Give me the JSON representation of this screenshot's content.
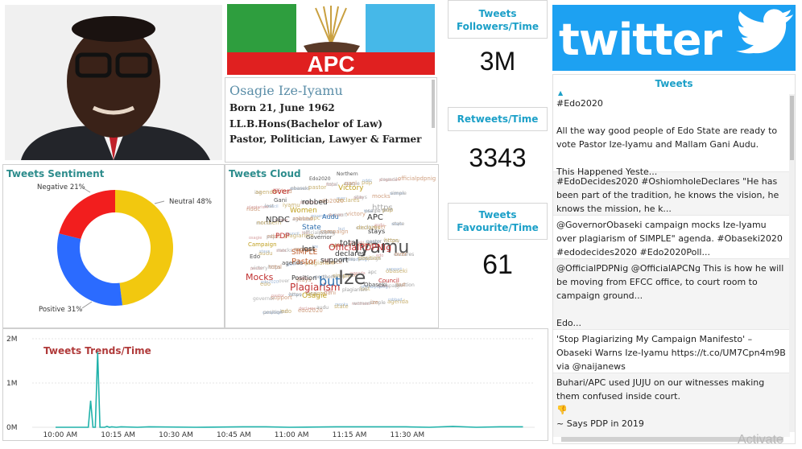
{
  "profile": {
    "name": "Osagie Ize-Iyamu",
    "born": "Born 21, June 1962",
    "degree": "LL.B.Hons(Bachelor of Law)",
    "occupation": "Pastor, Politician, Lawyer & Farmer"
  },
  "party": {
    "logo_text": "APC"
  },
  "kpis": [
    {
      "title": "Tweets Followers/Time",
      "value": "3M"
    },
    {
      "title": "Retweets/Time",
      "value": "3343"
    },
    {
      "title": "Tweets Favourite/Time",
      "value": "61"
    }
  ],
  "twitter": {
    "logo_text": "twitter",
    "header": "Tweets",
    "tweets": [
      "#Edo2020\n\nAll the way good people of Edo State are ready to vote Pastor Ize-Iyamu and Mallam Gani Audu.\n\nThis Happened Yeste...",
      "#EdoDecides2020 #OshiomholeDeclares \"He has been part of the tradition, he knows the vision, he knows the mission, he k...",
      "@GovernorObaseki campaign mocks Ize-Iyamu over plagiarism of SIMPLE\" agenda. #Obaseki2020 #edodecides2020 #Edo2020Poll...",
      "@OfficialPDPNig @OfficialAPCNg This is how he will be moving from EFCC office, to court room to campaign ground...\n\nEdo...",
      "'Stop Plagiarizing My Campaign Manifesto' – Obaseki Warns Ize-Iyamu https://t.co/UM7Cpn4m9B via @naijanews",
      "Buhari/APC used JUJU on our witnesses making them confused inside court.\n👎\n~ Says PDP in 2019"
    ]
  },
  "sentiment": {
    "title": "Tweets Sentiment",
    "labels": [
      "Neutral 48%",
      "Positive 31%",
      "Negative 21%"
    ]
  },
  "cloud": {
    "title": "Tweets  Cloud",
    "words": [
      "Iyamu",
      "Ize",
      "Plagiarism",
      "Mocks",
      "Osagie",
      "over",
      "Pastor",
      "but",
      "APC",
      "OfficialPDPNig",
      "SIMPLE",
      "NDDC",
      "State",
      "total",
      "declares",
      "support",
      "Position",
      "robbed",
      "lost",
      "Women",
      "PDP",
      "stays",
      "https",
      "Edo2020",
      "Obaseki",
      "Campaign",
      "agenda",
      "Council",
      "Northern",
      "Gani",
      "Audu",
      "Victory",
      "Edo",
      "Governor"
    ]
  },
  "trends": {
    "title": "Tweets Trends/Time",
    "y_ticks": [
      "2M",
      "1M",
      "0M"
    ],
    "x_ticks": [
      "10:00 AM",
      "10:15 AM",
      "10:30 AM",
      "10:45 AM",
      "11:00 AM",
      "11:15 AM",
      "11:30 AM"
    ]
  },
  "chart_data": [
    {
      "type": "pie",
      "title": "Tweets Sentiment",
      "categories": [
        "Neutral",
        "Positive",
        "Negative"
      ],
      "values": [
        48,
        31,
        21
      ],
      "colors": [
        "#f2c80f",
        "#2b6bff",
        "#f21e1e"
      ],
      "labels": [
        "Neutral 48%",
        "Positive 31%",
        "Negative 21%"
      ]
    },
    {
      "type": "line",
      "title": "Tweets Trends/Time",
      "xlabel": "",
      "ylabel": "",
      "ylim": [
        0,
        2000000
      ],
      "y_ticks": [
        "2M",
        "1M",
        "0M"
      ],
      "x_ticks": [
        "10:00 AM",
        "10:15 AM",
        "10:30 AM",
        "10:45 AM",
        "11:00 AM",
        "11:15 AM",
        "11:30 AM"
      ],
      "color": "#20b2aa",
      "x_minutes": [
        0,
        12,
        14,
        15,
        16,
        17,
        18,
        19,
        20,
        21,
        22,
        23,
        24,
        26,
        28,
        35,
        40,
        60,
        80,
        90,
        100,
        120,
        140,
        150,
        160,
        170,
        180,
        190,
        200
      ],
      "series": [
        {
          "values": [
            0,
            0,
            0,
            600000,
            0,
            0,
            1700000,
            0,
            0,
            0,
            20000,
            0,
            10000,
            0,
            10000,
            0,
            10000,
            0,
            10000,
            10000,
            0,
            10000,
            10000,
            10000,
            0,
            20000,
            0,
            10000,
            10000
          ]
        }
      ]
    }
  ],
  "watermark": "Activate"
}
